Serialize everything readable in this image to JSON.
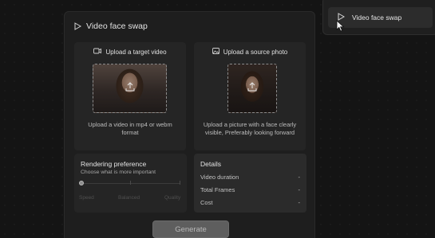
{
  "main_panel": {
    "title": "Video face swap",
    "upload_video": {
      "label": "Upload a target video",
      "description": "Upload a video in mp4 or webm format"
    },
    "upload_photo": {
      "label": "Upload a source photo",
      "description": "Upload a picture with a face clearly visible, Preferably looking forward"
    },
    "rendering": {
      "title": "Rendering preference",
      "subtitle": "Choose what is more important",
      "options": [
        "Speed",
        "Balanced",
        "Quality"
      ],
      "selected": "Speed"
    },
    "details": {
      "title": "Details",
      "rows": [
        {
          "label": "Video duration",
          "value": "-"
        },
        {
          "label": "Total Frames",
          "value": "-"
        },
        {
          "label": "Cost",
          "value": "-"
        }
      ]
    },
    "generate_label": "Generate"
  },
  "side_panel": {
    "item_label": "Video face swap"
  },
  "icons": {
    "title": "play-outline-icon",
    "video": "video-camera-icon",
    "photo": "image-icon",
    "upload": "upload-arrow-icon",
    "cursor": "mouse-pointer-icon"
  }
}
